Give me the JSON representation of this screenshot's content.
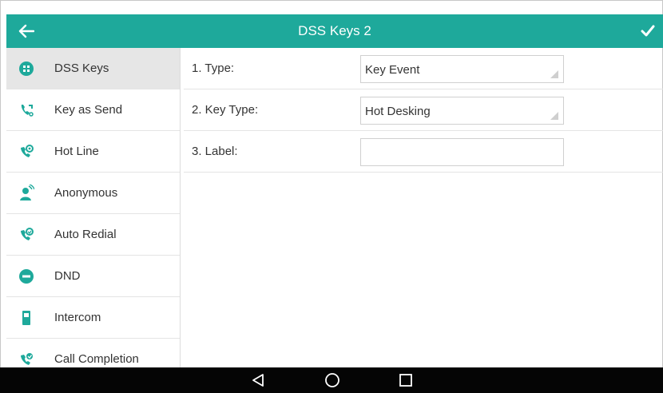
{
  "header": {
    "title": "DSS Keys 2",
    "back_icon": "back-arrow-icon",
    "confirm_icon": "checkmark-icon",
    "bar_color": "#1ea99b"
  },
  "sidebar": {
    "items": [
      {
        "label": "DSS Keys",
        "icon": "dss-keys-icon",
        "active": true
      },
      {
        "label": "Key as Send",
        "icon": "key-as-send-icon",
        "active": false
      },
      {
        "label": "Hot Line",
        "icon": "hot-line-icon",
        "active": false
      },
      {
        "label": "Anonymous",
        "icon": "anonymous-icon",
        "active": false
      },
      {
        "label": "Auto Redial",
        "icon": "auto-redial-icon",
        "active": false
      },
      {
        "label": "DND",
        "icon": "dnd-icon",
        "active": false
      },
      {
        "label": "Intercom",
        "icon": "intercom-icon",
        "active": false
      },
      {
        "label": "Call Completion",
        "icon": "call-completion-icon",
        "active": false
      }
    ],
    "icon_color": "#1ea99b",
    "active_bg": "#e6e6e6"
  },
  "settings": {
    "rows": [
      {
        "label": "1. Type:",
        "value": "Key Event",
        "kind": "dropdown"
      },
      {
        "label": "2. Key Type:",
        "value": "Hot Desking",
        "kind": "dropdown"
      },
      {
        "label": "3. Label:",
        "value": "",
        "kind": "text-input"
      }
    ]
  },
  "navbar": {
    "back": "nav-back-icon",
    "home": "nav-home-icon",
    "recents": "nav-recents-icon"
  }
}
